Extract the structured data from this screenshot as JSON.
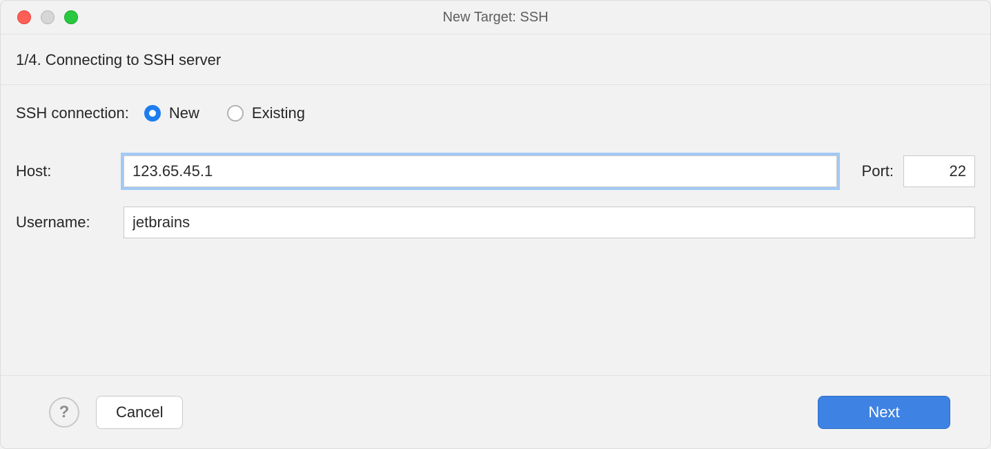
{
  "window": {
    "title": "New Target: SSH"
  },
  "step": {
    "text": "1/4. Connecting to SSH server"
  },
  "connection": {
    "label": "SSH connection:",
    "options": {
      "new": "New",
      "existing": "Existing"
    },
    "selected": "new"
  },
  "form": {
    "host_label": "Host:",
    "host_value": "123.65.45.1",
    "port_label": "Port:",
    "port_value": "22",
    "username_label": "Username:",
    "username_value": "jetbrains"
  },
  "footer": {
    "help": "?",
    "cancel": "Cancel",
    "next": "Next"
  }
}
